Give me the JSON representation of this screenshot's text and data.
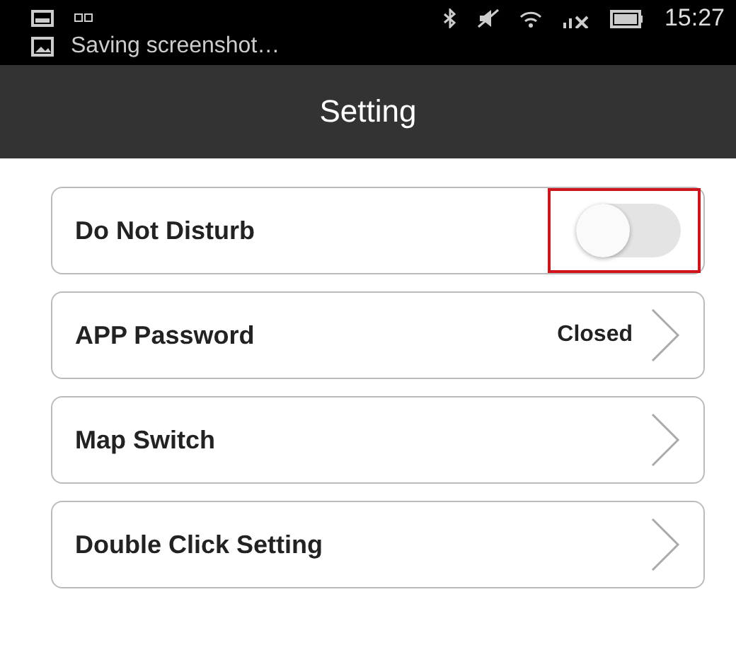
{
  "status_bar": {
    "time": "15:27",
    "notification": "Saving screenshot…"
  },
  "header": {
    "title": "Setting"
  },
  "settings": [
    {
      "kind": "toggle",
      "label": "Do Not Disturb",
      "on": false,
      "highlighted": true
    },
    {
      "kind": "link",
      "label": "APP Password",
      "value": "Closed"
    },
    {
      "kind": "link",
      "label": "Map Switch"
    },
    {
      "kind": "link",
      "label": "Double Click Setting"
    }
  ]
}
